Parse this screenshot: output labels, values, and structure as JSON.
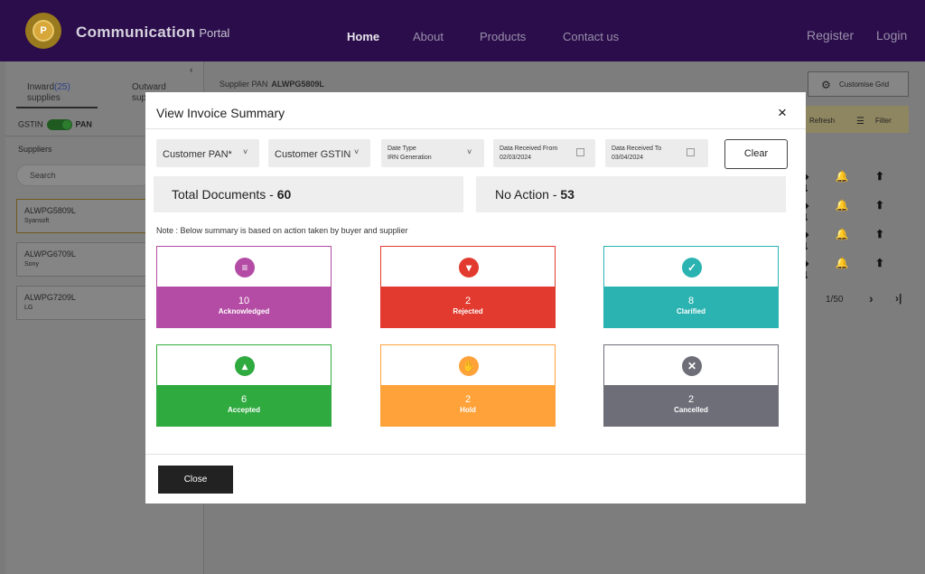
{
  "header": {
    "brand_bold": "Communication",
    "brand_rest": "Portal",
    "logo_letter": "P",
    "nav": [
      "Home",
      "About",
      "Products",
      "Contact us"
    ],
    "register": "Register",
    "login": "Login"
  },
  "sidebar": {
    "inward_label": "Inward",
    "inward_count": "(25)",
    "inward_sub": "supplies",
    "outward_label": "Outward",
    "outward_sub": "sup",
    "gstin": "GSTIN",
    "pan": "PAN",
    "suppliers_label": "Suppliers",
    "search_placeholder": "Search",
    "suppliers": [
      {
        "pan": "ALWPG5809L",
        "name": "Syansoft"
      },
      {
        "pan": "ALWPG6709L",
        "name": "Sony"
      },
      {
        "pan": "ALWPG7209L",
        "name": "LG"
      }
    ]
  },
  "background": {
    "supplier_pan_label": "Supplier PAN",
    "supplier_pan_value": "ALWPG5809L",
    "customise_grid": "Customise Grid",
    "refresh": "Refresh",
    "filter": "Filter",
    "row_icons": "◆ 🔔 ⬆ ⬇",
    "pager_text": "1/50",
    "pager_next": "›",
    "pager_last": "›|"
  },
  "modal": {
    "title": "View Invoice Summary",
    "close_x": "×",
    "filters": {
      "customer_pan": "Customer PAN*",
      "customer_gstin": "Customer GSTIN",
      "date_type_label": "Date Type",
      "date_type_value": "IRN Generation",
      "received_from_label": "Data Received From",
      "received_from_value": "02/03/2024",
      "received_to_label": "Data Received To",
      "received_to_value": "03/04/2024",
      "clear": "Clear"
    },
    "summary": {
      "total_label": "Total Documents - ",
      "total_value": "60",
      "noaction_label": "No Action - ",
      "noaction_value": "53"
    },
    "note": "Note : Below summary is based on action taken by buyer and supplier",
    "cards": [
      {
        "count": "10",
        "label": "Acknowledged",
        "color": "#b44ba4",
        "icon": "list-check-icon",
        "glyph": "≡"
      },
      {
        "count": "2",
        "label": "Rejected",
        "color": "#e23a2e",
        "icon": "thumbs-down-icon",
        "glyph": "▾"
      },
      {
        "count": "8",
        "label": "Clarified",
        "color": "#2bb3b1",
        "icon": "check-circle-icon",
        "glyph": "✓"
      },
      {
        "count": "6",
        "label": "Accepted",
        "color": "#2eaa3f",
        "icon": "thumbs-up-icon",
        "glyph": "▴"
      },
      {
        "count": "2",
        "label": "Hold",
        "color": "#ffa23a",
        "icon": "hand-stop-icon",
        "glyph": "✋"
      },
      {
        "count": "2",
        "label": "Cancelled",
        "color": "#6e6e78",
        "icon": "x-circle-icon",
        "glyph": "✕"
      }
    ],
    "close_button": "Close"
  }
}
